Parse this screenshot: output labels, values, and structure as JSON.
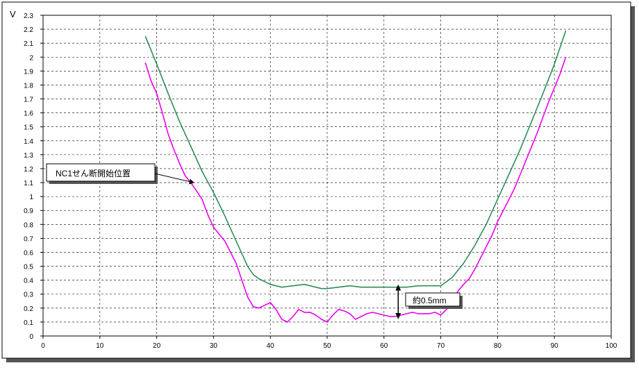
{
  "chart_data": {
    "type": "line",
    "title": "",
    "xlabel": "",
    "ylabel": "V",
    "xlim": [
      0,
      100
    ],
    "ylim": [
      0,
      2.3
    ],
    "x_ticks": [
      "0",
      "10",
      "20",
      "30",
      "40",
      "50",
      "60",
      "70",
      "80",
      "90",
      "100"
    ],
    "y_ticks": [
      "0",
      "0.1",
      "0.2",
      "0.3",
      "0.4",
      "0.5",
      "0.6",
      "0.7",
      "0.8",
      "0.9",
      "1",
      "1.1",
      "1.2",
      "1.3",
      "1.4",
      "1.5",
      "1.6",
      "1.7",
      "1.8",
      "1.9",
      "2",
      "2.1",
      "2.2",
      "2.3"
    ],
    "grid": true,
    "legend": "none",
    "colors": {
      "series_upper": "#2e8b57",
      "series_lower": "#ee00ee",
      "grid": "#000000",
      "shadow": "#555555"
    },
    "series": [
      {
        "color": "#2e8b57",
        "x": [
          18,
          20,
          22,
          24,
          26,
          28,
          30,
          32,
          34,
          36,
          37,
          38,
          40,
          42,
          44,
          46,
          48,
          49,
          50,
          52,
          54,
          56,
          58,
          60,
          62,
          64,
          66,
          68,
          70,
          72,
          74,
          76,
          78,
          80,
          82,
          84,
          86,
          88,
          90,
          92
        ],
        "y": [
          2.15,
          1.95,
          1.74,
          1.54,
          1.36,
          1.18,
          1.03,
          0.86,
          0.68,
          0.5,
          0.44,
          0.41,
          0.37,
          0.35,
          0.36,
          0.37,
          0.35,
          0.34,
          0.34,
          0.35,
          0.36,
          0.35,
          0.35,
          0.35,
          0.35,
          0.35,
          0.36,
          0.36,
          0.36,
          0.42,
          0.52,
          0.65,
          0.8,
          0.98,
          1.16,
          1.34,
          1.54,
          1.74,
          1.95,
          2.19
        ]
      },
      {
        "color": "#ee00ee",
        "x": [
          18,
          19,
          20,
          21,
          22,
          23,
          24,
          25,
          26,
          27,
          28,
          29,
          30,
          31,
          32,
          33,
          34,
          35,
          36,
          37,
          38,
          39,
          40,
          41,
          42,
          43,
          44,
          45,
          46,
          47,
          48,
          49,
          50,
          51,
          52,
          53,
          54,
          55,
          56,
          57,
          58,
          59,
          60,
          61,
          62,
          63,
          64,
          65,
          66,
          67,
          68,
          69,
          70,
          71,
          72,
          73,
          74,
          75,
          76,
          77,
          78,
          79,
          80,
          81,
          82,
          83,
          84,
          85,
          86,
          87,
          88,
          89,
          90,
          91,
          92
        ],
        "y": [
          1.96,
          1.83,
          1.74,
          1.6,
          1.45,
          1.34,
          1.24,
          1.15,
          1.1,
          1.04,
          0.98,
          0.87,
          0.78,
          0.73,
          0.68,
          0.6,
          0.52,
          0.4,
          0.28,
          0.21,
          0.2,
          0.22,
          0.24,
          0.19,
          0.12,
          0.1,
          0.14,
          0.19,
          0.17,
          0.17,
          0.15,
          0.12,
          0.1,
          0.15,
          0.19,
          0.18,
          0.16,
          0.12,
          0.14,
          0.16,
          0.17,
          0.16,
          0.15,
          0.14,
          0.14,
          0.15,
          0.16,
          0.17,
          0.16,
          0.16,
          0.16,
          0.17,
          0.15,
          0.19,
          0.24,
          0.32,
          0.37,
          0.41,
          0.48,
          0.56,
          0.64,
          0.72,
          0.82,
          0.9,
          0.98,
          1.06,
          1.16,
          1.26,
          1.36,
          1.46,
          1.57,
          1.68,
          1.78,
          1.88,
          2.0
        ]
      }
    ],
    "annotations": [
      {
        "text": "NC1せん断開始位置",
        "target": [
          26.5,
          1.1
        ]
      },
      {
        "text": "約0.5mm",
        "arrow_x": 62.5,
        "arrow_y": [
          0.13,
          0.36
        ]
      }
    ]
  }
}
